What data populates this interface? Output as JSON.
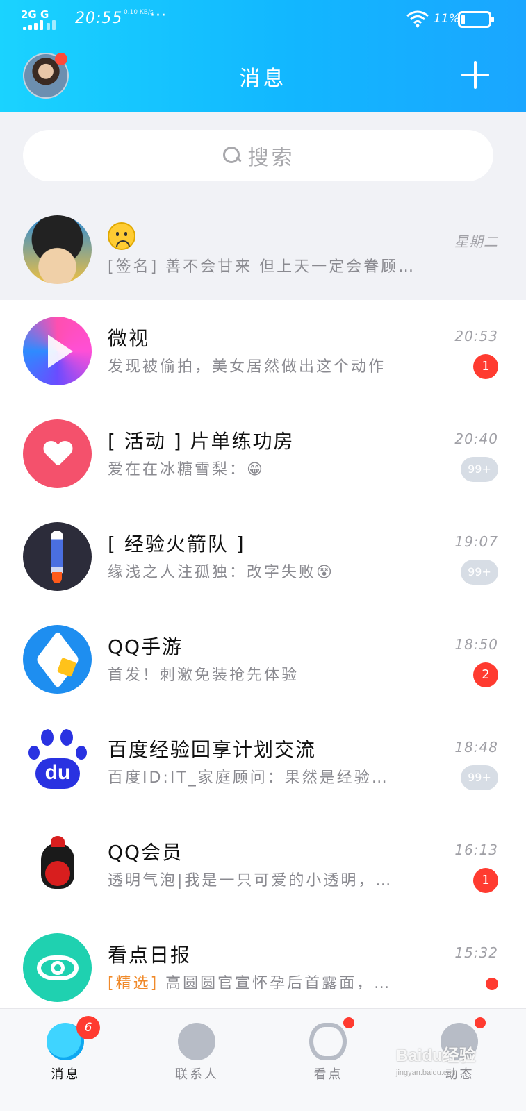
{
  "status_bar": {
    "network": "2G G",
    "time": "20:55",
    "speed": "0.10 KB/s",
    "more": "···",
    "battery_percent": "11%"
  },
  "header": {
    "title": "消息"
  },
  "search": {
    "placeholder": "搜索"
  },
  "pinned": {
    "time": "星期二",
    "subtitle": "[签名] 善不会甘来 但上天一定会眷顾…"
  },
  "conversations": [
    {
      "title": "微视",
      "subtitle": "发现被偷拍，美女居然做出这个动作",
      "time": "20:53",
      "badge": "1",
      "badge_style": "red"
    },
    {
      "title": "[ 活动 ] 片单练功房",
      "subtitle": "爱在在冰糖雪梨：😁",
      "time": "20:40",
      "badge": "99+",
      "badge_style": "grey"
    },
    {
      "title": "[ 经验火箭队 ]",
      "subtitle": "缘浅之人注孤独：改字失败😵",
      "time": "19:07",
      "badge": "99+",
      "badge_style": "grey"
    },
    {
      "title": "QQ手游",
      "subtitle": "首发！刺激免装抢先体验",
      "time": "18:50",
      "badge": "2",
      "badge_style": "red"
    },
    {
      "title": "百度经验回享计划交流",
      "subtitle": "百度ID:IT_家庭顾问：果然是经验…",
      "time": "18:48",
      "badge": "99+",
      "badge_style": "grey"
    },
    {
      "title": "QQ会员",
      "subtitle": "透明气泡|我是一只可爱的小透明，…",
      "time": "16:13",
      "badge": "1",
      "badge_style": "red"
    },
    {
      "title": "看点日报",
      "subtitle_tag": "[精选]",
      "subtitle": "高圆圆官宣怀孕后首露面，…",
      "time": "15:32",
      "badge": "",
      "badge_style": "dot"
    }
  ],
  "bottom_nav": {
    "items": [
      {
        "label": "消息",
        "badge": "6"
      },
      {
        "label": "联系人"
      },
      {
        "label": "看点"
      },
      {
        "label": "动态"
      }
    ]
  },
  "watermark": {
    "text": "Baidu经验",
    "url": "jingyan.baidu.com"
  },
  "colors": {
    "header_gradient_start": "#1ad3ff",
    "header_gradient_end": "#1aa6ff",
    "badge_red": "#ff3b30",
    "badge_grey": "#d7dde5",
    "tag_orange": "#f08a2a"
  }
}
